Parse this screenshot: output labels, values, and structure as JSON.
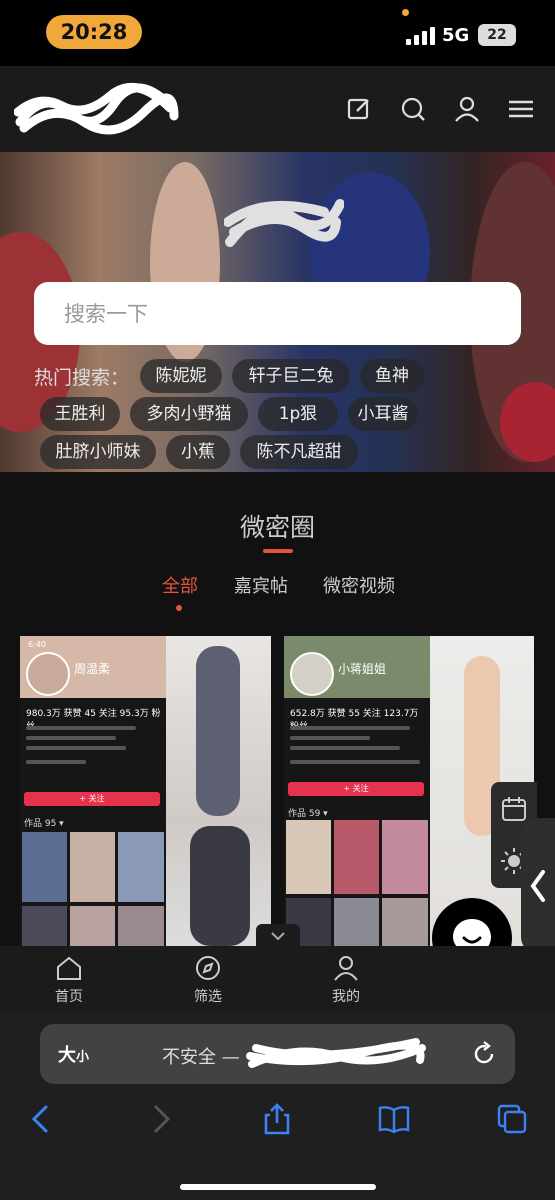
{
  "status_bar": {
    "time": "20:28",
    "network": "5G",
    "battery": "22"
  },
  "header": {
    "logo_alt": "scribbled-out site logo",
    "icons": [
      "edit-icon",
      "search-icon",
      "user-icon",
      "menu-icon"
    ]
  },
  "hero": {
    "search_placeholder": "搜索一下",
    "hot_label": "热门搜索：",
    "tags": [
      "陈妮妮",
      "轩子巨二兔",
      "鱼神",
      "王胜利",
      "多肉小野猫",
      "1p狠",
      "小耳酱",
      "肚脐小师妹",
      "小蕉",
      "陈不凡超甜"
    ]
  },
  "section": {
    "title": "微密圈",
    "tabs": [
      {
        "label": "全部",
        "active": true
      },
      {
        "label": "嘉宾帖",
        "active": false
      },
      {
        "label": "微密视频",
        "active": false
      }
    ]
  },
  "cards": [
    {
      "profile_name": "周温柔",
      "stats": "980.3万 获赞   45 关注   95.3万 粉丝",
      "works_label": "作品 95 ▾",
      "follow_label": "+ 关注",
      "status_time": "6:40"
    },
    {
      "profile_name": "小蒋姐姐",
      "stats": "652.8万 获赞   55 关注   123.7万 粉丝",
      "works_label": "作品 59 ▾",
      "follow_label": "+ 关注",
      "status_time": ""
    }
  ],
  "bottom_nav": [
    {
      "label": "首页",
      "icon": "home-icon"
    },
    {
      "label": "筛选",
      "icon": "compass-icon"
    },
    {
      "label": "我的",
      "icon": "profile-icon"
    }
  ],
  "browser": {
    "text_size_main": "大",
    "text_size_small": "小",
    "security_label": "不安全 —",
    "icons": [
      "back-icon",
      "forward-icon",
      "share-icon",
      "bookmarks-icon",
      "tabs-icon",
      "reload-icon"
    ]
  },
  "colors": {
    "accent": "#e5533d",
    "time_pill": "#f0a83a",
    "background": "#111111"
  }
}
